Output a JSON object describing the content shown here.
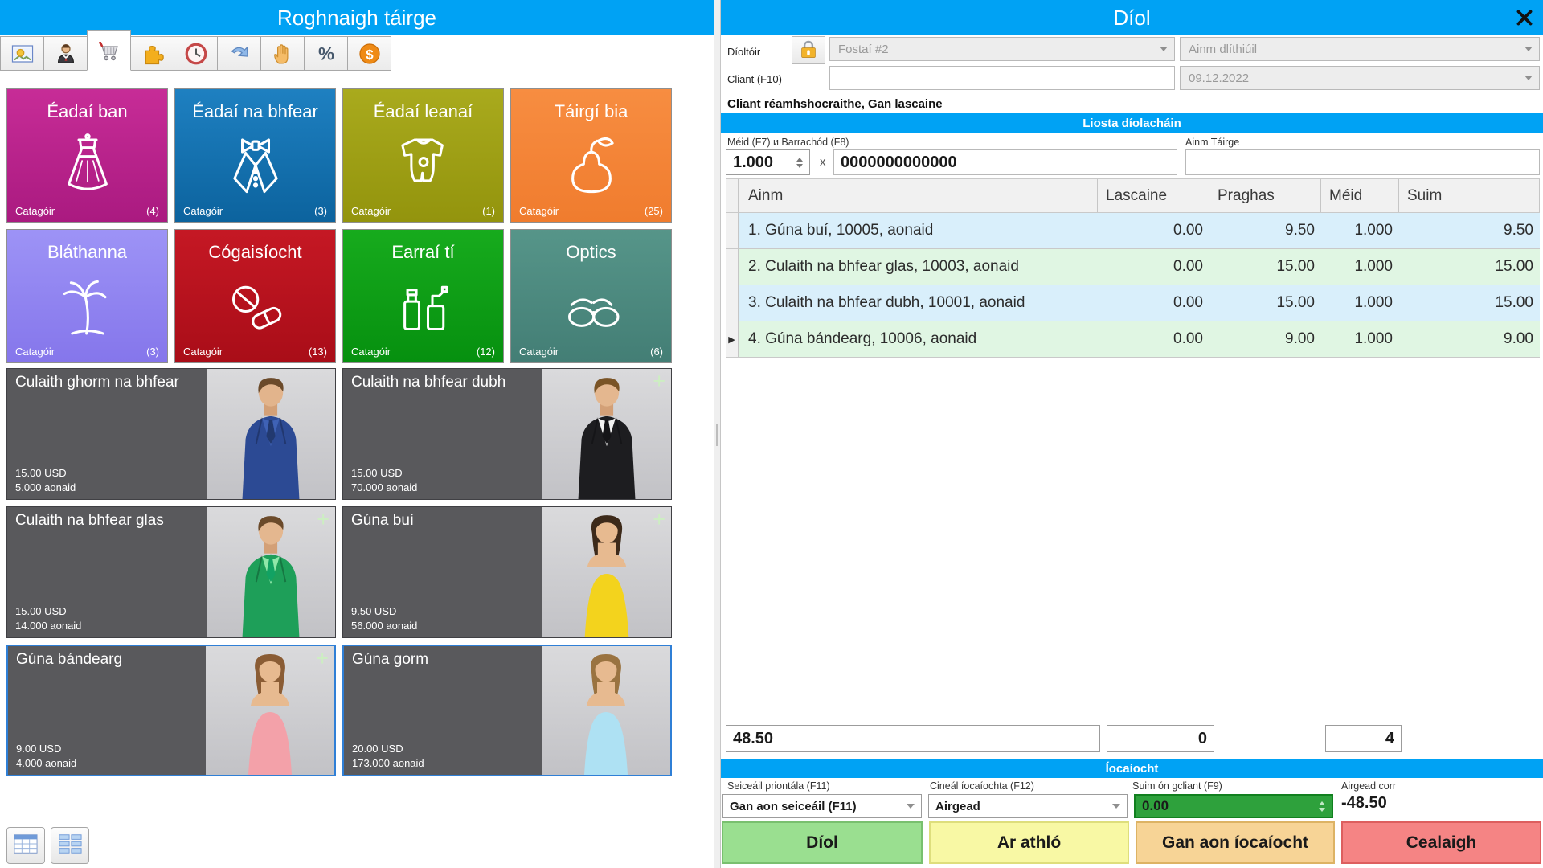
{
  "accent_color": "#00a2f4",
  "left_panel": {
    "title": "Roghnaigh táirge",
    "toolbar": [
      {
        "icon": "image-icon",
        "selected": false
      },
      {
        "icon": "person-icon",
        "selected": false
      },
      {
        "icon": "cart-icon",
        "selected": true
      },
      {
        "icon": "puzzle-icon",
        "selected": false
      },
      {
        "icon": "clock-icon",
        "selected": false
      },
      {
        "icon": "redo-arrow-icon",
        "selected": false
      },
      {
        "icon": "hand-icon",
        "selected": false
      },
      {
        "icon": "percent-icon",
        "selected": false
      },
      {
        "icon": "dollar-icon",
        "selected": false
      }
    ],
    "category_label": "Catagóir",
    "categories": [
      {
        "label": "Éadaí ban",
        "count": "(4)",
        "icon": "dress-icon",
        "color_top": "#c72c97",
        "color_bottom": "#aa1a80"
      },
      {
        "label": "Éadaí na bhfear",
        "count": "(3)",
        "icon": "tuxedo-icon",
        "color_top": "#1e80c1",
        "color_bottom": "#0c639e"
      },
      {
        "label": "Éadaí leanaí",
        "count": "(1)",
        "icon": "baby-onesie-icon",
        "color_top": "#a9aa1d",
        "color_bottom": "#93940d"
      },
      {
        "label": "Táirgí bia",
        "count": "(25)",
        "icon": "pear-icon",
        "color_top": "#f78d41",
        "color_bottom": "#f07c2e"
      },
      {
        "label": "Bláthanna",
        "count": "(3)",
        "icon": "palm-icon",
        "color_top": "#9d93f6",
        "color_bottom": "#8576eb"
      },
      {
        "label": "Cógaisíocht",
        "count": "(13)",
        "icon": "pills-icon",
        "color_top": "#c51824",
        "color_bottom": "#a90d18"
      },
      {
        "label": "Earraí tí",
        "count": "(12)",
        "icon": "bottles-icon",
        "color_top": "#17ab1d",
        "color_bottom": "#06900f"
      },
      {
        "label": "Optics",
        "count": "(6)",
        "icon": "glasses-icon",
        "color_top": "#569589",
        "color_bottom": "#437e75"
      }
    ],
    "products": [
      {
        "label": "Culaith ghorm na bhfear",
        "price": "15.00 USD",
        "stock": "5.000 aonaid",
        "plus": "",
        "selected": false,
        "figure": {
          "style": "suit",
          "suit": "#2c4a94",
          "shirt": "#3f62b5",
          "tie": "#22396f",
          "skin": "#e2b48c",
          "hair": "#6b4a2a"
        }
      },
      {
        "label": "Culaith na bhfear dubh",
        "price": "15.00 USD",
        "stock": "70.000 aonaid",
        "plus": "+",
        "selected": false,
        "figure": {
          "style": "suit",
          "suit": "#1d1d20",
          "shirt": "#f2f2f2",
          "tie": "#151518",
          "skin": "#e4b78f",
          "hair": "#7a5426"
        }
      },
      {
        "label": "Culaith na bhfear glas",
        "price": "15.00 USD",
        "stock": "14.000 aonaid",
        "plus": "+",
        "selected": false,
        "figure": {
          "style": "suit",
          "suit": "#1e9f59",
          "shirt": "#8fe7a9",
          "tie": "#12a263",
          "skin": "#e4b78f",
          "hair": "#6b4a2a"
        }
      },
      {
        "label": "Gúna buí",
        "price": "9.50 USD",
        "stock": "56.000 aonaid",
        "plus": "+",
        "selected": false,
        "figure": {
          "style": "dress",
          "suit": "#f3d31d",
          "skin": "#e7ba90",
          "hair": "#3d2a1a"
        }
      },
      {
        "label": "Gúna bándearg",
        "price": "9.00 USD",
        "stock": "4.000 aonaid",
        "plus": "+",
        "selected": true,
        "figure": {
          "style": "dress",
          "suit": "#f3a1a9",
          "skin": "#e7ba90",
          "hair": "#8a5c34"
        }
      },
      {
        "label": "Gúna gorm",
        "price": "20.00 USD",
        "stock": "173.000 aonaid",
        "plus": "",
        "selected": true,
        "figure": {
          "style": "dress",
          "suit": "#aee1f3",
          "skin": "#e7ba90",
          "hair": "#9a7340"
        }
      }
    ],
    "view_buttons": [
      {
        "icon": "table-view-icon"
      },
      {
        "icon": "grid-view-icon"
      }
    ]
  },
  "right_panel": {
    "title": "Díol",
    "close_icon": "close-icon",
    "seller_label": "Díoltóir",
    "seller_value": "Fostaí #2",
    "legal_name_value": "Ainm dlíthiúil",
    "client_label": "Cliant (F10)",
    "client_value": "",
    "date_value": "09.12.2022",
    "client_note": "Cliant réamhshocraithe, Gan lascaine",
    "list_header": "Liosta díolacháin",
    "qty_barcode_label": "Méid (F7) и Barrachód (F8)",
    "qty_value": "1.000",
    "times_label": "x",
    "barcode_value": "0000000000000",
    "product_name_label": "Ainm Táirge",
    "product_name_value": "",
    "table": {
      "columns": [
        "Ainm",
        "Lascaine",
        "Praghas",
        "Méid",
        "Suim"
      ],
      "row_colors": [
        "#d9effb",
        "#e0f6e3"
      ],
      "current_marker": "▶",
      "rows": [
        {
          "ainm": "1. Gúna buí, 10005, aonaid",
          "lascaine": "0.00",
          "praghas": "9.50",
          "meid": "1.000",
          "suim": "9.50",
          "current": false
        },
        {
          "ainm": "2. Culaith na bhfear glas, 10003, aonaid",
          "lascaine": "0.00",
          "praghas": "15.00",
          "meid": "1.000",
          "suim": "15.00",
          "current": false
        },
        {
          "ainm": "3. Culaith na bhfear dubh, 10001, aonaid",
          "lascaine": "0.00",
          "praghas": "15.00",
          "meid": "1.000",
          "suim": "15.00",
          "current": false
        },
        {
          "ainm": "4. Gúna bándearg, 10006, aonaid",
          "lascaine": "0.00",
          "praghas": "9.00",
          "meid": "1.000",
          "suim": "9.00",
          "current": true
        }
      ]
    },
    "totals": {
      "total": "48.50",
      "discount": "0",
      "items": "4"
    },
    "payment": {
      "header": "Íocaíocht",
      "print_check_label": "Seiceáil priontála (F11)",
      "print_check_value": "Gan aon seiceáil (F11)",
      "payment_type_label": "Cineál íocaíochta (F12)",
      "payment_type_value": "Airgead",
      "client_sum_label": "Suim ón gcliant (F9)",
      "client_sum_value": "0.00",
      "client_sum_bg": "#2ea13c",
      "client_sum_border": "#11801f",
      "change_label": "Airgead corr",
      "change_value": "-48.50",
      "buttons": [
        {
          "label": "Díol",
          "bg": "#9adf90",
          "border": "#79c06f"
        },
        {
          "label": "Ar athló",
          "bg": "#f8f8a4",
          "border": "#dede7c"
        },
        {
          "label": "Gan aon íocaíocht",
          "bg": "#f7d496",
          "border": "#ddb364"
        },
        {
          "label": "Cealaigh",
          "bg": "#f58484",
          "border": "#dd5f5f"
        }
      ]
    }
  }
}
